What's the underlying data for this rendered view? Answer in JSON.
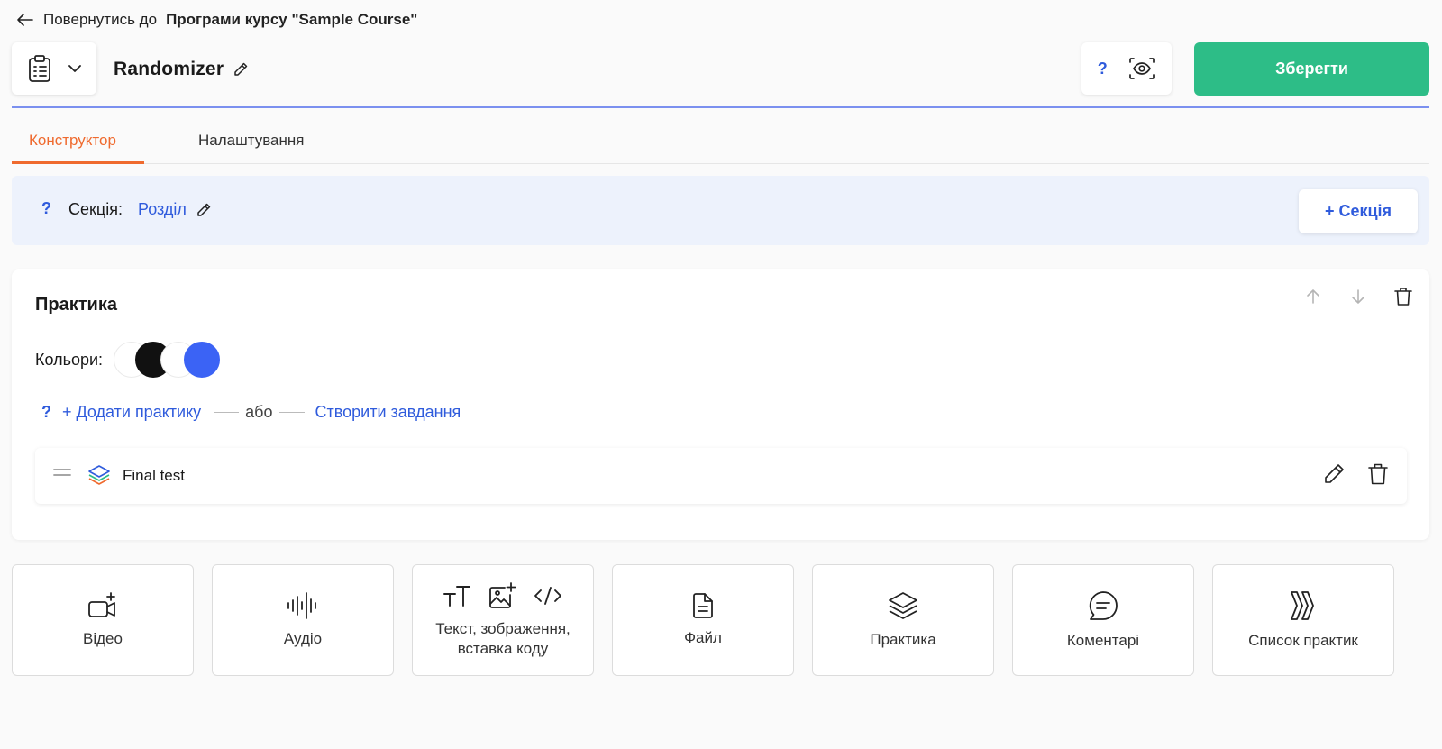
{
  "header": {
    "back_prefix": "Повернутись до",
    "back_target": "Програми курсу \"Sample Course\"",
    "lesson_title": "Randomizer",
    "save_label": "Зберегти",
    "help_mark": "?"
  },
  "tabs": [
    {
      "label": "Конструктор",
      "active": true
    },
    {
      "label": "Налаштування",
      "active": false
    }
  ],
  "section": {
    "help_mark": "?",
    "label": "Секція:",
    "name": "Розділ",
    "add_label": "+ Секція"
  },
  "practice": {
    "title": "Практика",
    "colors_label": "Кольори:",
    "swatches": [
      "#ffffff",
      "#111111",
      "#ffffff",
      "#3b63f5"
    ],
    "help_mark": "?",
    "add_practice": "+ Додати практику",
    "or": "або",
    "create_task": "Створити завдання",
    "items": [
      {
        "name": "Final test"
      }
    ]
  },
  "blocks": [
    {
      "label": "Відео",
      "icon": "video-add-icon"
    },
    {
      "label": "Аудіо",
      "icon": "audio-wave-icon"
    },
    {
      "label": "Текст, зображення, вставка коду",
      "icon": "text-image-code-icons"
    },
    {
      "label": "Файл",
      "icon": "file-icon"
    },
    {
      "label": "Практика",
      "icon": "layers-icon"
    },
    {
      "label": "Коментарі",
      "icon": "comment-icon"
    },
    {
      "label": "Список практик",
      "icon": "practice-list-icon"
    }
  ],
  "colors": {
    "accent_blue": "#2f5bdc",
    "save_green": "#2dbd87",
    "tab_orange": "#ef6a2e",
    "section_bg": "#edf2fc"
  }
}
